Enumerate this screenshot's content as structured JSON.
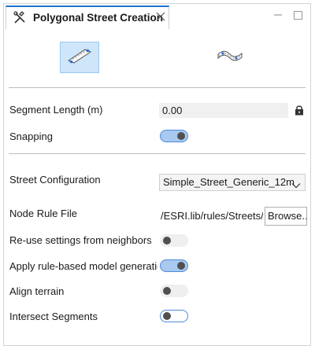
{
  "tab": {
    "title": "Polygonal Street Creation",
    "icon": "tools-icon",
    "close_icon": "close-icon"
  },
  "window_controls": {
    "minimize_icon": "minimize-icon",
    "maximize_icon": "maximize-icon"
  },
  "modes": [
    {
      "name": "straight-street-mode",
      "icon": "straight-street-icon",
      "selected": true
    },
    {
      "name": "curved-street-mode",
      "icon": "curved-street-icon",
      "selected": false
    }
  ],
  "fields": {
    "segment_length_label": "Segment Length (m)",
    "segment_length_value": "0.00",
    "snapping_label": "Snapping",
    "snapping_on": true,
    "street_config_label": "Street Configuration",
    "street_config_value": "Simple_Street_Generic_12m",
    "node_rule_label": "Node Rule File",
    "node_rule_value": "/ESRI.lib/rules/Streets/Node.cga",
    "browse_label": "Browse...",
    "reuse_label": "Re-use settings from neighbors",
    "reuse_on": false,
    "apply_rule_label": "Apply rule-based model generation",
    "apply_rule_on": true,
    "align_label": "Align terrain",
    "align_on": false,
    "intersect_label": "Intersect Segments",
    "intersect_on": false
  },
  "colors": {
    "accent": "#1e74c9",
    "selected_bg": "#cfe5fa",
    "toggle_on_bg": "#aac9f0"
  }
}
